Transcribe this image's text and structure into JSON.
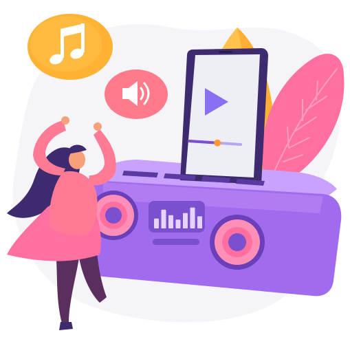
{
  "illustration": {
    "subject": "",
    "icons": [
      "music-note-icon",
      "speaker-volume-icon",
      "play-icon"
    ],
    "colors": {
      "background_blob": "#f4f4f9",
      "orange_light": "#ffc24a",
      "orange_dark": "#ff9a2e",
      "pink_main": "#ff6fa0",
      "pink_dark": "#e84b86",
      "pink_bubble": "#ff7b8c",
      "purple_main": "#b07cf0",
      "purple_dark": "#7a4fd0",
      "purple_deep": "#3e2a6e",
      "phone_screen": "#eeeef5",
      "play_button": "#8a6ff0",
      "skin": "#f7a07a"
    },
    "phone": {
      "progress": 0.55
    },
    "equalizer": {
      "levels": [
        0.45,
        0.85,
        0.6,
        0.4,
        0.7,
        0.95,
        0.55
      ]
    }
  }
}
